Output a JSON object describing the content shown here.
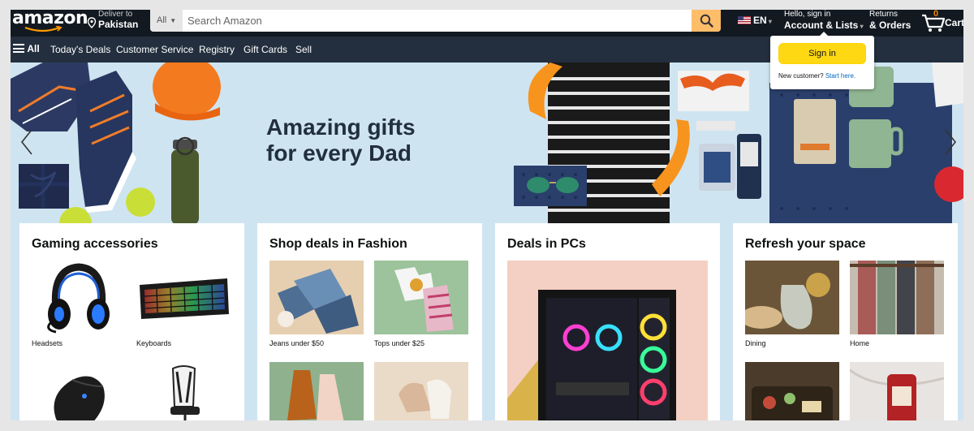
{
  "header": {
    "logo_text": "amazon",
    "deliver": {
      "line1": "Deliver to",
      "line2": "Pakistan"
    },
    "search": {
      "category": "All",
      "placeholder": "Search Amazon"
    },
    "language": "EN",
    "account": {
      "line1": "Hello, sign in",
      "line2": "Account & Lists"
    },
    "returns": {
      "line1": "Returns",
      "line2": "& Orders"
    },
    "cart": {
      "count": "0",
      "label": "Cart"
    }
  },
  "subnav": {
    "all_label": "All",
    "items": [
      "Today's Deals",
      "Customer Service",
      "Registry",
      "Gift Cards",
      "Sell"
    ]
  },
  "hero": {
    "line1": "Amazing gifts",
    "line2": "for every Dad"
  },
  "signin_popover": {
    "button": "Sign in",
    "new_customer": "New customer?",
    "start_here": "Start here."
  },
  "cards": [
    {
      "title": "Gaming accessories",
      "tiles": [
        "Headsets",
        "Keyboards",
        "",
        ""
      ]
    },
    {
      "title": "Shop deals in Fashion",
      "tiles": [
        "Jeans under $50",
        "Tops under $25",
        "",
        ""
      ]
    },
    {
      "title": "Deals in PCs"
    },
    {
      "title": "Refresh your space",
      "tiles": [
        "Dining",
        "Home",
        "",
        ""
      ]
    }
  ],
  "colors": {
    "nav_top": "#131921",
    "nav_sub": "#232f3e",
    "search_button": "#febd69",
    "signin_button": "#ffd814",
    "link": "#0066c0"
  }
}
